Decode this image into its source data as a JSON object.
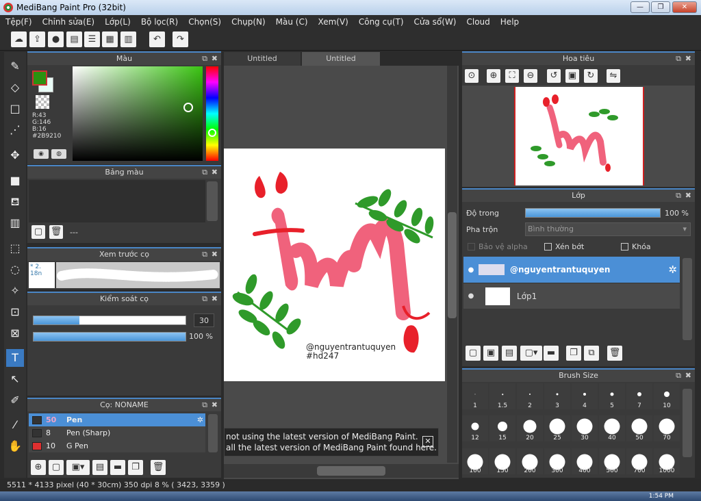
{
  "window": {
    "title": "MediBang Paint Pro (32bit)",
    "btn_min": "—",
    "btn_max": "❐",
    "btn_close": "✕"
  },
  "menu": [
    "Tệp(F)",
    "Chỉnh sửa(E)",
    "Lớp(L)",
    "Bộ lọc(R)",
    "Chọn(S)",
    "Chụp(N)",
    "Màu (C)",
    "Xem(V)",
    "Công cụ(T)",
    "Cửa sổ(W)",
    "Cloud",
    "Help"
  ],
  "tabs": [
    "Untitled",
    "Untitled"
  ],
  "color_panel": {
    "title": "Màu",
    "readout_r": "R:43",
    "readout_g": "G:146",
    "readout_b": "B:16",
    "readout_hex": "#2B9210",
    "fg_color": "#2b9210",
    "bg_color": "#e9fbf6"
  },
  "palette_panel": {
    "title": "Bảng màu",
    "value": "---"
  },
  "brush_preview": {
    "title": "Xem trước cọ",
    "size_label": "* 2. 18n"
  },
  "brush_control": {
    "title": "Kiểm soát cọ",
    "size_value": "30",
    "opacity_value": "100 %",
    "size_fraction": 0.3,
    "opacity_fraction": 1.0
  },
  "brush_list": {
    "title": "Cọ: NONAME",
    "items": [
      {
        "size": "50",
        "name": "Pen",
        "color": "#333333",
        "selected": true
      },
      {
        "size": "8",
        "name": "Pen (Sharp)",
        "color": "#333333",
        "selected": false
      },
      {
        "size": "10",
        "name": "G Pen",
        "color": "#e03030",
        "selected": false
      }
    ]
  },
  "canvas": {
    "signature_line1": "@nguyentrantuquyen",
    "signature_line2": "#hd247"
  },
  "notification": {
    "line1": "not using the latest version of MediBang Paint.",
    "line2": "all the latest version of MediBang Paint found here.",
    "close": "✕"
  },
  "navigator": {
    "title": "Hoa tiêu"
  },
  "layer_panel": {
    "title": "Lớp",
    "opacity_label": "Độ trong",
    "opacity_value": "100 %",
    "opacity_fraction": 1.0,
    "blend_label": "Pha trộn",
    "blend_value": "Bình thường",
    "protect_alpha": "Bảo vệ alpha",
    "clip": "Xén bớt",
    "lock": "Khóa",
    "layers": [
      {
        "name": "@nguyentrantuquyen",
        "selected": true
      },
      {
        "name": "Lớp1",
        "selected": false
      }
    ]
  },
  "brush_size": {
    "title": "Brush Size",
    "sizes": [
      "1",
      "1.5",
      "2",
      "3",
      "4",
      "5",
      "7",
      "10",
      "12",
      "15",
      "20",
      "25",
      "30",
      "40",
      "50",
      "70",
      "100",
      "150",
      "200",
      "300",
      "400",
      "500",
      "700",
      "1000"
    ]
  },
  "status": {
    "text": "5511 * 4133 pixel  (40 * 30cm)  350 dpi  8 %  ( 3423, 3359 )"
  },
  "taskbar": {
    "clock": "1:54 PM"
  }
}
